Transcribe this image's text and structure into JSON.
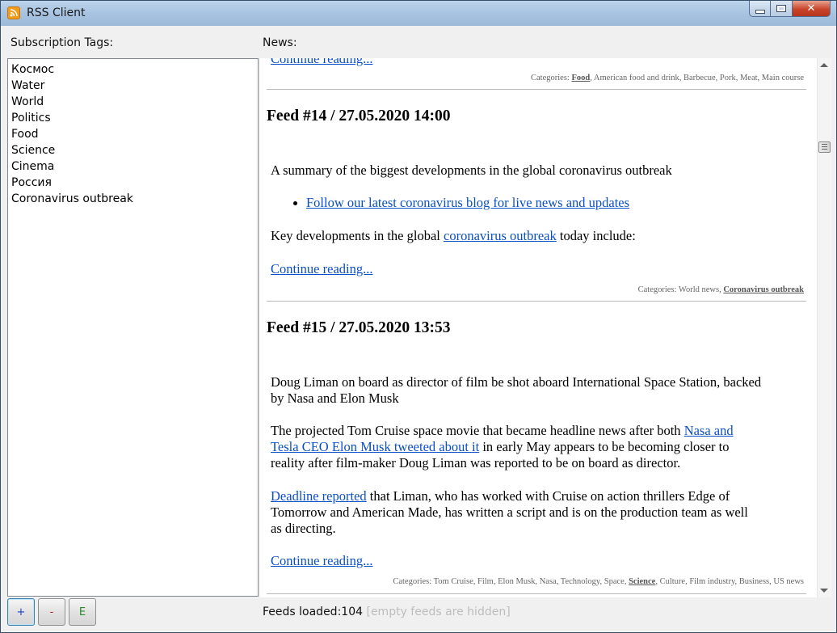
{
  "window": {
    "title": "RSS Client"
  },
  "left_panel": {
    "header": "Subscription Tags:",
    "tags": [
      "Космос",
      "Water",
      "World",
      "Politics",
      "Food",
      "Science",
      "Cinema",
      "Россия",
      "Coronavirus outbreak"
    ]
  },
  "news_panel": {
    "header": "News:",
    "prev_feed": {
      "continue_label": "Continue reading...",
      "categories_label": "Categories:",
      "categories_rest": "American food and drink, Barbecue, Pork, Meat, Main course",
      "categories_bold": "Food"
    },
    "feeds": [
      {
        "title": "Feed #14 / 27.05.2020 14:00",
        "summary": "A summary of the biggest developments in the global coronavirus outbreak",
        "bullet_link": "Follow our latest coronavirus blog for live news and updates",
        "key_prefix": "Key developments in the global",
        "key_link": "coronavirus outbreak",
        "key_suffix": "today include:",
        "continue_label": "Continue reading...",
        "categories_label": "Categories:",
        "categories_plain": "World news,",
        "categories_bold": "Coronavirus outbreak"
      },
      {
        "title": "Feed #15 / 27.05.2020 13:53",
        "p1_line1": "Doug Liman on board as director of film be shot aboard International Space Station, backed",
        "p1_line2": "by Nasa and Elon Musk",
        "p2_line1_text": "The projected Tom Cruise space movie that became headline news after both",
        "p2_line1_link": "Nasa and",
        "p2_line2_link": "Tesla CEO Elon Musk tweeted about it",
        "p2_line2_text": "in early May appears to be becoming closer to",
        "p2_line3": "reality after film-maker Doug Liman was reported to be on board as director.",
        "p3_link": "Deadline reported",
        "p3_line1_text": "that Liman, who has worked with Cruise on action thrillers Edge of",
        "p3_line2": "Tomorrow and American Made, has written a script and is on the production team as well",
        "p3_line3": "as directing.",
        "continue_label": "Continue reading...",
        "categories_label": "Categories:",
        "categories_pre": "Tom Cruise, Film, Elon Musk, Nasa, Technology, Space,",
        "categories_bold": "Science",
        "categories_post": ", Culture, Film industry, Business, US news"
      }
    ]
  },
  "buttons": {
    "add": "+",
    "remove": "-",
    "edit": "E"
  },
  "status": {
    "label": "Feeds loaded:",
    "count": "104",
    "note": "[empty feeds are hidden]"
  },
  "colors": {
    "add": "#1f3fbf",
    "remove": "#c02020",
    "edit": "#2a8a2a",
    "link": "#0b4fc7"
  }
}
